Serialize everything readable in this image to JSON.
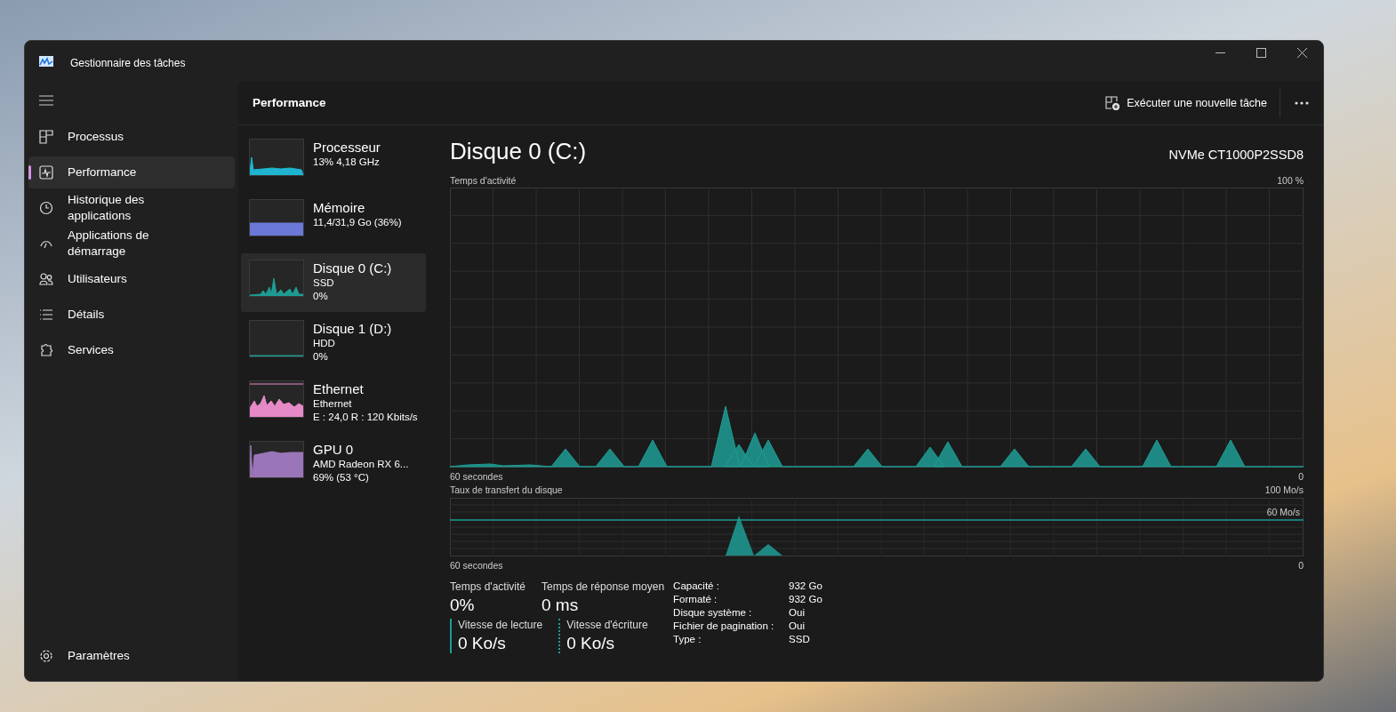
{
  "window": {
    "title": "Gestionnaire des tâches"
  },
  "sidebar": {
    "items": [
      {
        "label": "Processus",
        "selected": false
      },
      {
        "label": "Performance",
        "selected": true
      },
      {
        "label": "Historique des applications",
        "selected": false
      },
      {
        "label": "Applications de démarrage",
        "selected": false
      },
      {
        "label": "Utilisateurs",
        "selected": false
      },
      {
        "label": "Détails",
        "selected": false
      },
      {
        "label": "Services",
        "selected": false
      }
    ],
    "settings": "Paramètres"
  },
  "header": {
    "title": "Performance",
    "run_task": "Exécuter une nouvelle tâche"
  },
  "devices": [
    {
      "kind": "cpu",
      "name": "Processeur",
      "lines": [
        "13%  4,18 GHz"
      ],
      "color": "#1fb5d0",
      "selected": false
    },
    {
      "kind": "memory",
      "name": "Mémoire",
      "lines": [
        "11,4/31,9 Go (36%)"
      ],
      "color": "#6b78d8",
      "selected": false
    },
    {
      "kind": "disk",
      "name": "Disque 0 (C:)",
      "lines": [
        "SSD",
        "0%"
      ],
      "color": "#1e9c94",
      "selected": true
    },
    {
      "kind": "idle",
      "name": "Disque 1 (D:)",
      "lines": [
        "HDD",
        "0%"
      ],
      "color": "#1e9c94",
      "selected": false
    },
    {
      "kind": "network",
      "name": "Ethernet",
      "lines": [
        "Ethernet",
        "E : 24,0 R : 120 Kbits/s"
      ],
      "color": "#e58ac7",
      "selected": false
    },
    {
      "kind": "gpu",
      "name": "GPU 0",
      "lines": [
        "AMD Radeon RX 6...",
        "69%  (53 °C)"
      ],
      "color": "#9a76b8",
      "selected": false
    }
  ],
  "detail": {
    "title": "Disque 0 (C:)",
    "model": "NVMe CT1000P2SSD8",
    "activity_chart": {
      "label": "Temps d'activité",
      "max": "100 %",
      "time": "60 secondes",
      "min": "0"
    },
    "transfer_chart": {
      "label": "Taux de transfert du disque",
      "max": "100 Mo/s",
      "line_label": "60 Mo/s",
      "time": "60 secondes",
      "min": "0"
    },
    "stats": [
      {
        "label": "Temps d'activité",
        "value": "0%"
      },
      {
        "label": "Temps de réponse moyen",
        "value": "0 ms"
      }
    ],
    "speeds": [
      {
        "kind": "solid",
        "label": "Vitesse de lecture",
        "value": "0 Ko/s"
      },
      {
        "kind": "dotted",
        "label": "Vitesse d'écriture",
        "value": "0 Ko/s"
      }
    ],
    "properties": [
      {
        "label": "Capacité :",
        "value": "932 Go"
      },
      {
        "label": "Formaté :",
        "value": "932 Go"
      },
      {
        "label": "Disque système :",
        "value": "Oui"
      },
      {
        "label": "Fichier de pagination :",
        "value": "Oui"
      },
      {
        "label": "Type :",
        "value": "SSD"
      }
    ]
  }
}
